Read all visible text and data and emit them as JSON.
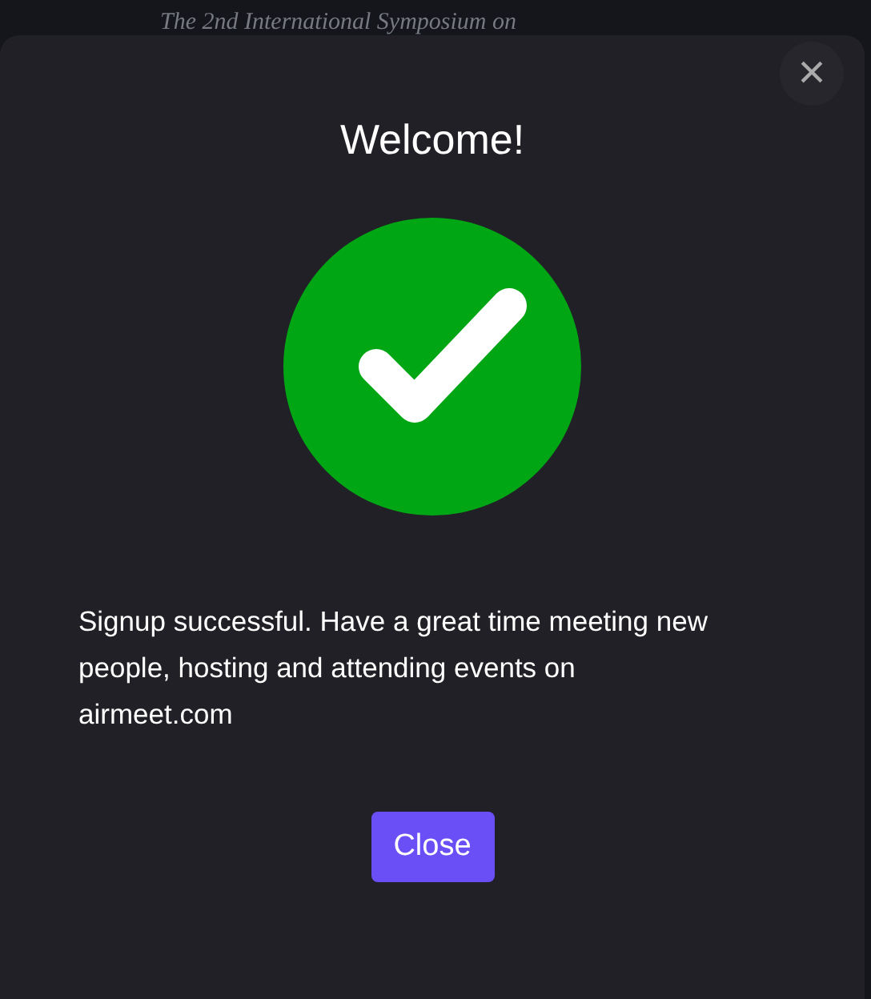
{
  "background": {
    "heading": "The 2nd International Symposium on"
  },
  "modal": {
    "close_icon": "×",
    "title": "Welcome!",
    "message": "Signup successful. Have a great time meeting new people, hosting and attending events on airmeet.com",
    "button": "Close"
  }
}
